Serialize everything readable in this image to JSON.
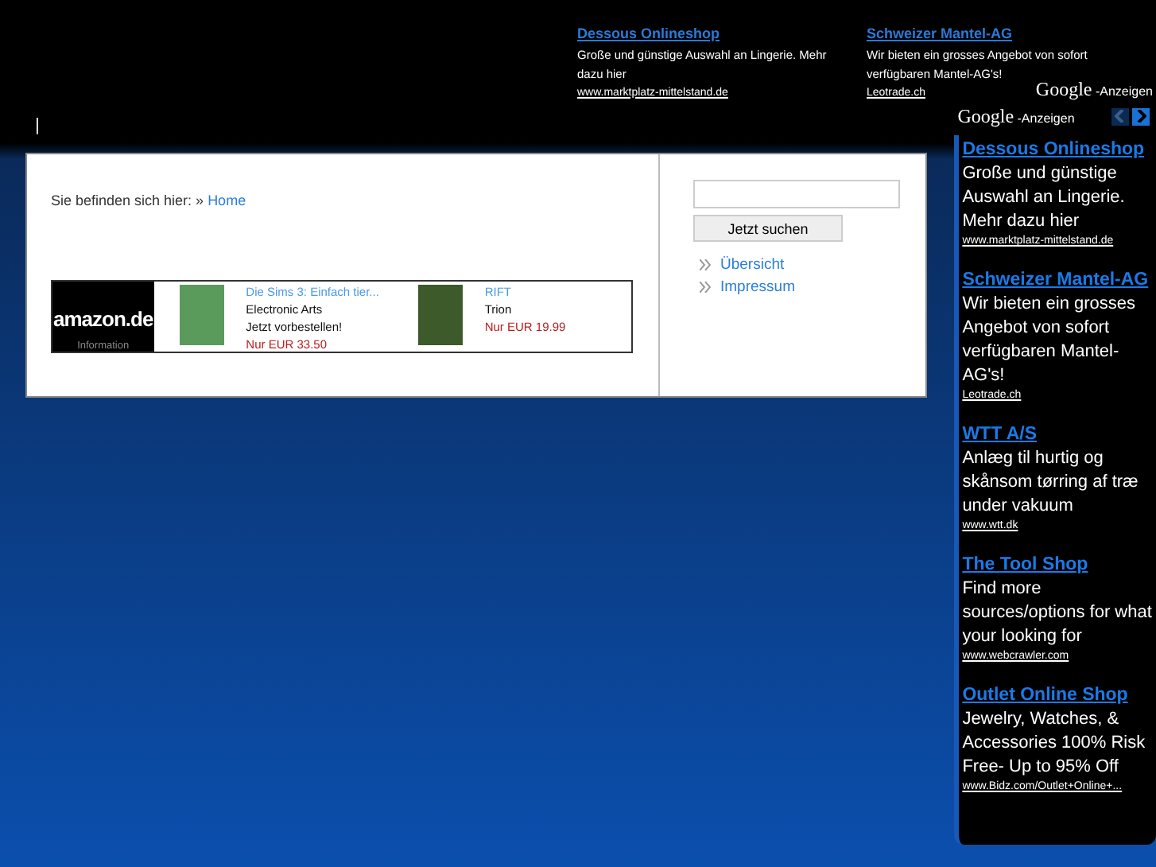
{
  "top_ads": [
    {
      "title": "Dessous Onlineshop",
      "text": "Große und günstige Auswahl an Lingerie. Mehr dazu hier",
      "url": "www.marktplatz-mittelstand.de"
    },
    {
      "title": "Schweizer Mantel-AG",
      "text": "Wir bieten ein grosses Angebot von sofort verfügbaren Mantel-AG's!",
      "url": "Leotrade.ch"
    }
  ],
  "top_ads_label": {
    "brand": "Google",
    "suffix": "-Anzeigen"
  },
  "header_mark": "|",
  "breadcrumb": {
    "label": "Sie befinden sich hier: »",
    "link": "Home"
  },
  "amazon_widget": {
    "logo": "amazon.de",
    "info": "Information",
    "products": [
      {
        "title": "Die Sims 3: Einfach tier...",
        "maker": "Electronic Arts",
        "note": "Jetzt vorbestellen!",
        "price": "Nur EUR 33.50"
      },
      {
        "title": "RIFT",
        "maker": "Trion",
        "price": "Nur EUR 19.99"
      }
    ]
  },
  "search": {
    "button": "Jetzt suchen"
  },
  "nav": [
    "Übersicht",
    "Impressum"
  ],
  "side_ads_label": {
    "brand": "Google",
    "suffix": "-Anzeigen"
  },
  "side_ads": [
    {
      "title": "Dessous Onlineshop",
      "text": "Große und günstige Auswahl an Lingerie. Mehr dazu hier",
      "url": "www.marktplatz-mittelstand.de"
    },
    {
      "title": "Schweizer Mantel-AG",
      "text": "Wir bieten ein grosses Angebot von sofort verfügbaren Mantel-AG's!",
      "url": "Leotrade.ch"
    },
    {
      "title": "WTT A/S",
      "text": "Anlæg til hurtig og skånsom tørring af træ under vakuum",
      "url": "www.wtt.dk"
    },
    {
      "title": "The Tool Shop",
      "text": "Find more sources/options for what your looking for",
      "url": "www.webcrawler.com"
    },
    {
      "title": "Outlet Online Shop",
      "text": "Jewelry, Watches, & Accessories 100% Risk Free- Up to 95% Off",
      "url": "www.Bidz.com/Outlet+Online+..."
    }
  ]
}
